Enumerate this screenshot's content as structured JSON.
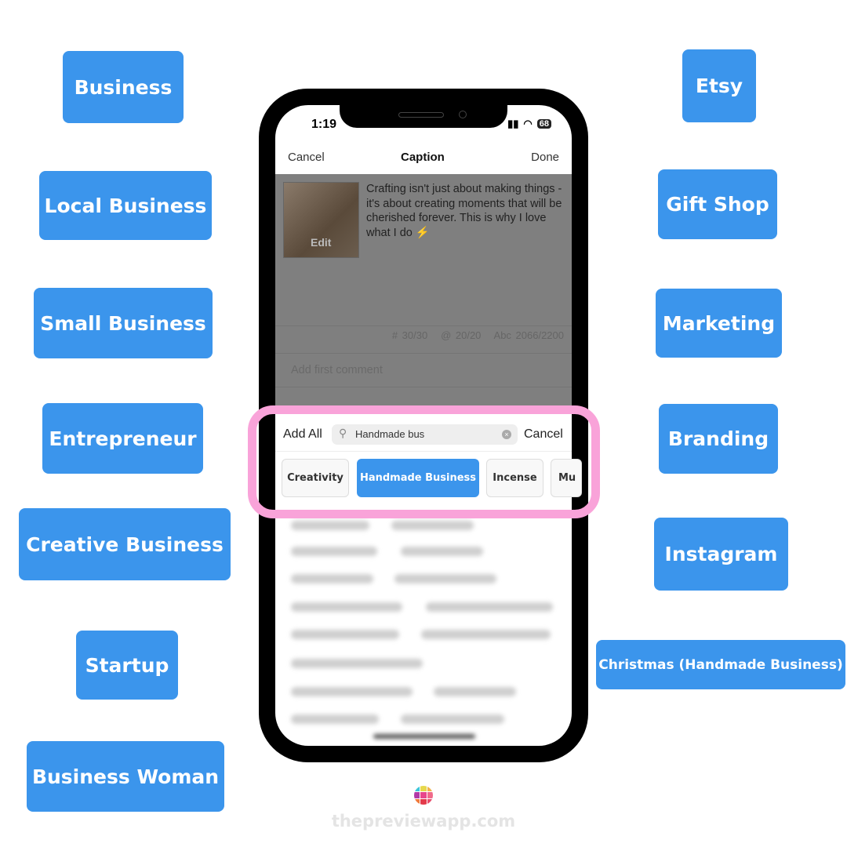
{
  "tags_left": [
    "Business",
    "Local Business",
    "Small Business",
    "Entrepreneur",
    "Creative Business",
    "Startup",
    "Business Woman"
  ],
  "tags_right": [
    "Etsy",
    "Gift Shop",
    "Marketing",
    "Branding",
    "Instagram",
    "Christmas (Handmade Business)"
  ],
  "tag_color": "#3b95ec",
  "highlight_color": "#f9a3d9",
  "status": {
    "time": "1:19",
    "battery": "68"
  },
  "nav": {
    "cancel": "Cancel",
    "title": "Caption",
    "done": "Done"
  },
  "post": {
    "thumb_label": "Edit",
    "caption": "Crafting isn't just about making things - it's about creating moments that will be cherished forever. This is why I love what I do ⚡"
  },
  "counts": {
    "hashtags": "# 30/30",
    "mentions": "@ 20/20",
    "chars": "Abc 2066/2200"
  },
  "comment_placeholder": "Add first comment",
  "search": {
    "add_all": "Add All",
    "value": "Handmade bus",
    "cancel": "Cancel"
  },
  "chips": [
    {
      "label": "Creativity",
      "selected": false
    },
    {
      "label": "Handmade Business",
      "selected": true
    },
    {
      "label": "Incense",
      "selected": false
    },
    {
      "label": "Mu",
      "selected": false
    }
  ],
  "footer": {
    "domain": "thepreviewapp.com"
  }
}
